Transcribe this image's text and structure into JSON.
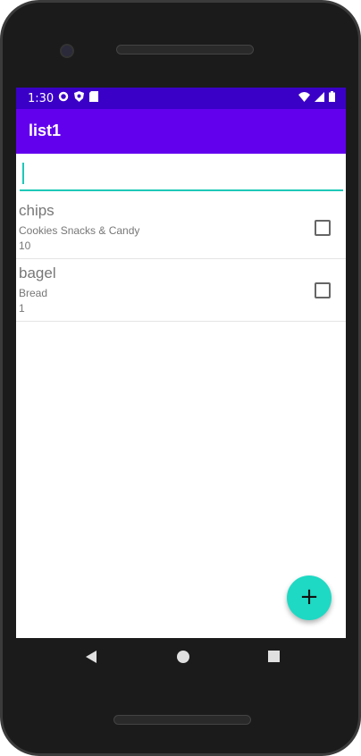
{
  "status_bar": {
    "time": "1:30",
    "left_icons": [
      "gear-icon",
      "shield-icon",
      "sd-card-icon"
    ],
    "right_icons": [
      "wifi-icon",
      "signal-icon",
      "battery-icon"
    ]
  },
  "app_bar": {
    "title": "list1"
  },
  "search": {
    "value": "",
    "placeholder": ""
  },
  "items": [
    {
      "name": "chips",
      "category": "Cookies Snacks & Candy",
      "quantity": "10",
      "checked": false
    },
    {
      "name": "bagel",
      "category": "Bread",
      "quantity": "1",
      "checked": false
    }
  ],
  "fab": {
    "label": "+"
  },
  "colors": {
    "status_bar": "#3a00c8",
    "app_bar": "#6200ee",
    "accent": "#1ed9c4"
  }
}
